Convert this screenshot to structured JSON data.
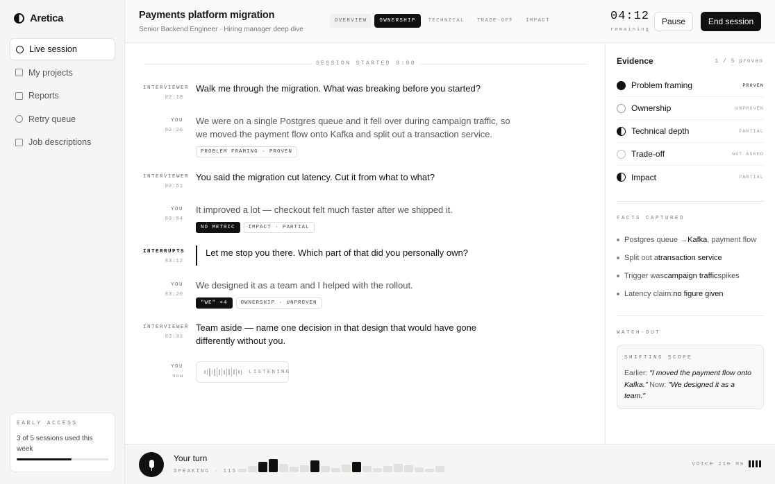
{
  "app": {
    "name": "Aretica"
  },
  "sidebar": {
    "items": [
      {
        "label": "Live session"
      },
      {
        "label": "My projects"
      },
      {
        "label": "Reports"
      },
      {
        "label": "Retry queue"
      },
      {
        "label": "Job descriptions"
      }
    ],
    "promo": {
      "label": "EARLY ACCESS",
      "text": "3 of 5 sessions used this week",
      "progress": 0.6
    }
  },
  "header": {
    "title": "Payments platform migration",
    "subtitle": "Senior Backend Engineer · Hiring manager deep dive",
    "tabs": [
      "OVERVIEW",
      "OWNERSHIP",
      "TECHNICAL",
      "TRADE-OFF",
      "IMPACT"
    ],
    "active_tab": "OWNERSHIP",
    "timer": "04:12",
    "timer_label": "remaining",
    "pause_label": "Pause",
    "end_label": "End session"
  },
  "transcript": {
    "session_started": "SESSION STARTED 8:00",
    "messages": [
      {
        "speaker": "INTERVIEWER",
        "time": "02:18",
        "text": "Walk me through the migration. What was breaking before you started?"
      },
      {
        "speaker": "YOU",
        "time": "02:26",
        "text": "We were on a single Postgres queue and it fell over during campaign traffic, so we moved the payment flow onto Kafka and split out a transaction service.",
        "chips": [
          "PROBLEM FRAMING · PROVEN"
        ]
      },
      {
        "speaker": "INTERVIEWER",
        "time": "02:51",
        "text": "You said the migration cut latency. Cut it from what to what?"
      },
      {
        "speaker": "YOU",
        "time": "03:04",
        "text": "It improved a lot — checkout felt much faster after we shipped it.",
        "chips": [
          "NO METRIC",
          "IMPACT · PARTIAL"
        ]
      },
      {
        "speaker": "INTERRUPTS",
        "time": "03:12",
        "text": "Let me stop you there. Which part of that did you personally own?"
      },
      {
        "speaker": "YOU",
        "time": "03:20",
        "text": "We designed it as a team and I helped with the rollout.",
        "chips": [
          "\"WE\" ×4",
          "OWNERSHIP · UNPROVEN"
        ]
      },
      {
        "speaker": "INTERVIEWER",
        "time": "03:31",
        "text": "Team aside — name one decision in that design that would have gone differently without you."
      },
      {
        "speaker": "YOU",
        "time": "now",
        "listening": "LISTENING"
      }
    ]
  },
  "evidence": {
    "title": "Evidence",
    "count": "1 / 5 proven",
    "items": [
      {
        "label": "Problem framing",
        "status": "PROVEN"
      },
      {
        "label": "Ownership",
        "status": "UNPROVEN"
      },
      {
        "label": "Technical depth",
        "status": "PARTIAL"
      },
      {
        "label": "Trade-off",
        "status": "NOT ASKED"
      },
      {
        "label": "Impact",
        "status": "PARTIAL"
      }
    ],
    "facts_label": "FACTS CAPTURED",
    "facts": [
      {
        "prefix": "Postgres queue → ",
        "strong": "Kafka",
        "suffix": ", payment flow"
      },
      {
        "prefix": "Split out a ",
        "strong": "transaction service",
        "suffix": ""
      },
      {
        "prefix": "Trigger was ",
        "strong": "campaign traffic",
        "suffix": " spikes"
      },
      {
        "prefix": "Latency claim: ",
        "strong": "no figure given",
        "suffix": ""
      }
    ],
    "watch_label": "WATCH-OUT",
    "watch_card": {
      "label": "SHIFTING SCOPE",
      "earlier_label": "Earlier:",
      "earlier_quote": "\"I moved the payment flow onto Kafka.\"",
      "now_label": "Now:",
      "now_quote": "\"We designed it as a team.\""
    }
  },
  "bottom": {
    "turn_label": "Your turn",
    "speaking": "SPEAKING · 11S",
    "voice": "VOICE 210 MS",
    "levels": [
      0.25,
      0.45,
      0.75,
      0.95,
      0.6,
      0.4,
      0.5,
      0.85,
      0.45,
      0.3,
      0.55,
      0.75,
      0.45,
      0.3,
      0.45,
      0.6,
      0.5,
      0.35,
      0.25,
      0.45
    ]
  }
}
